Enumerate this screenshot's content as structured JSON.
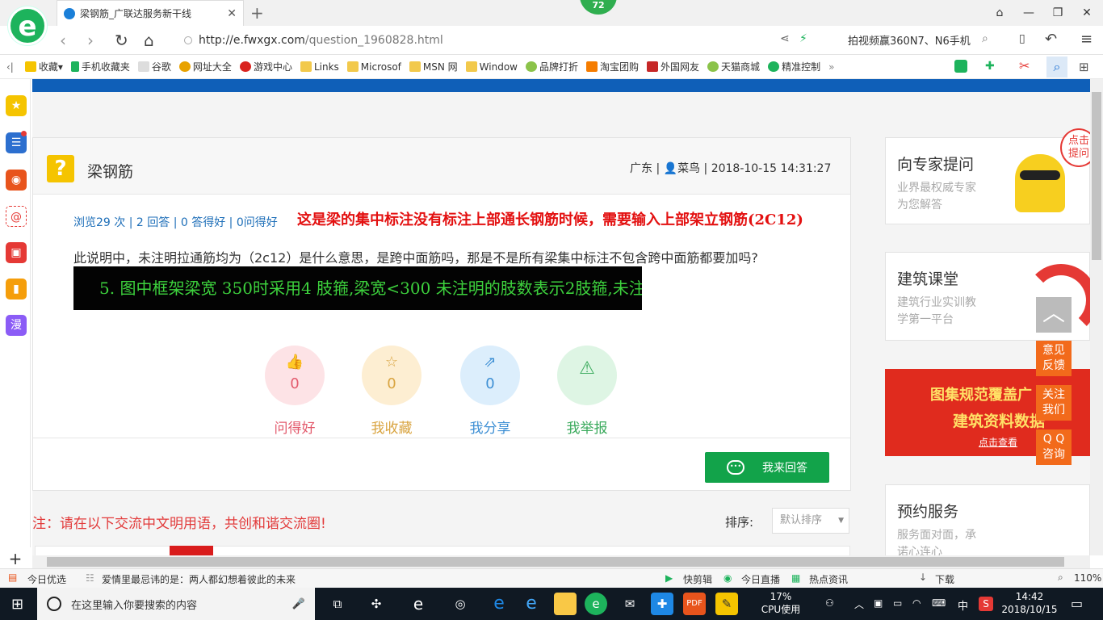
{
  "browser": {
    "tab_title": "梁钢筋_广联达服务新干线",
    "badge": "72",
    "url_host": "http://e.fwxgx.com",
    "url_path": "/question_1960828.html",
    "search_hint": "拍视频赢360N7、N6手机"
  },
  "bookmarks": [
    "收藏",
    "手机收藏夹",
    "谷歌",
    "网址大全",
    "游戏中心",
    "Links",
    "Microsof",
    "MSN 网",
    "Window",
    "品牌打折",
    "淘宝团购",
    "外国网友",
    "天猫商城",
    "精准控制"
  ],
  "question": {
    "title": "梁钢筋",
    "location": "广东",
    "user": "菜鸟",
    "datetime": "2018-10-15 14:31:27",
    "views": "浏览29 次",
    "answers": "2 回答",
    "good": "0 答得好",
    "asked_good": "0问得好",
    "annotation": "这是梁的集中标注没有标注上部通长钢筋时候，需要输入上部架立钢筋(2C12)",
    "body": "此说明中，未注明拉通筋均为（2c12）是什么意思，是跨中面筋吗，那是不是所有梁集中标注不包含跨中面筋都要加吗?",
    "image_text": "5. 图中框架梁宽 350时采用4 肢箍,梁宽<300 未注明的肢数表示2肢箍,未注明拉通筋均为 (2Φ12);"
  },
  "actions": [
    {
      "count": "0",
      "label": "问得好"
    },
    {
      "count": "0",
      "label": "我收藏"
    },
    {
      "count": "0",
      "label": "我分享"
    },
    {
      "count": "0",
      "label": "我举报"
    }
  ],
  "answer_button": "我来回答",
  "comment_note": "注：请在以下交流中文明用语，共创和谐交流圈!",
  "sort": {
    "label": "排序:",
    "value": "默认排序"
  },
  "sidebar": {
    "expert": {
      "title": "向专家提问",
      "sub1": "业界最权威专家",
      "sub2": "为您解答",
      "bubble1": "点击",
      "bubble2": "提问"
    },
    "course": {
      "title": "建筑课堂",
      "sub1": "建筑行业实训教",
      "sub2": "学第一平台"
    },
    "banner": {
      "line1": "图集规范覆盖广",
      "line2": "建筑资料数据",
      "link": "点击查看"
    },
    "booking": {
      "title": "预约服务",
      "sub1": "服务面对面，承",
      "sub2": "诺心连心"
    }
  },
  "floating": {
    "feedback": [
      "意见",
      "反馈"
    ],
    "follow": [
      "关注",
      "我们"
    ],
    "qq": [
      "Q Q",
      "咨询"
    ]
  },
  "statusbar": {
    "daily": "今日优选",
    "news": "爱情里最忌讳的是：两人都幻想着彼此的未来",
    "clip": "快剪辑",
    "live": "今日直播",
    "hot": "热点资讯",
    "download": "下载",
    "zoom": "110%"
  },
  "taskbar": {
    "search": "在这里输入你要搜索的内容",
    "cpu_pct": "17%",
    "cpu_label": "CPU使用",
    "ime": "中",
    "time": "14:42",
    "date": "2018/10/15"
  }
}
